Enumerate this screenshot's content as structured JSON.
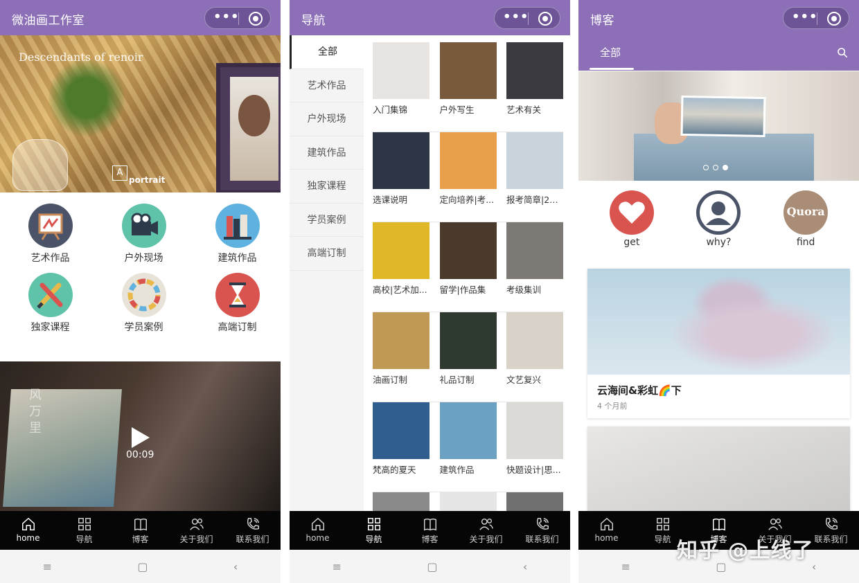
{
  "screen_home": {
    "title": "微油画工作室",
    "hero_caption": "Descendants of renoir",
    "hero_brand": "portrait",
    "hero_logo": "A",
    "grid": [
      {
        "label": "艺术作品",
        "icon": "easel-icon",
        "color": "#4a5367"
      },
      {
        "label": "户外现场",
        "icon": "camera-icon",
        "color": "#5fc3aa"
      },
      {
        "label": "建筑作品",
        "icon": "books-icon",
        "color": "#5fb2e0"
      },
      {
        "label": "独家课程",
        "icon": "brushes-icon",
        "color": "#5fc3aa"
      },
      {
        "label": "学员案例",
        "icon": "palette-icon",
        "color": "#e7e3d8"
      },
      {
        "label": "高端订制",
        "icon": "hourglass-icon",
        "color": "#d9534f"
      }
    ],
    "video": {
      "time": "00:09",
      "overlay_text": "风万里"
    }
  },
  "screen_nav": {
    "title": "导航",
    "categories": [
      "全部",
      "艺术作品",
      "户外现场",
      "建筑作品",
      "独家课程",
      "学员案例",
      "高端订制"
    ],
    "active_category": "全部",
    "thumbs": [
      {
        "caption": "入门集锦",
        "color": "#e8e4e2"
      },
      {
        "caption": "户外写生",
        "color": "#7a5a3c"
      },
      {
        "caption": "艺术有关",
        "color": "#3b3a40"
      },
      {
        "caption": "选课说明",
        "color": "#2c3644"
      },
      {
        "caption": "定向培养|考...",
        "color": "#e9a04a"
      },
      {
        "caption": "报考简章|20...",
        "color": "#c9d3dc"
      },
      {
        "caption": "高校|艺术加...",
        "color": "#e0b727"
      },
      {
        "caption": "留学|作品集",
        "color": "#4a3a2c"
      },
      {
        "caption": "考级集训",
        "color": "#7d7a76"
      },
      {
        "caption": "油画订制",
        "color": "#c09a55"
      },
      {
        "caption": "礼品订制",
        "color": "#2e3a2f"
      },
      {
        "caption": "文艺复兴",
        "color": "#d9d2c8"
      },
      {
        "caption": "梵高的夏天",
        "color": "#2f5e8f"
      },
      {
        "caption": "建筑作品",
        "color": "#6ba2c4"
      },
      {
        "caption": "快题设计|思...",
        "color": "#dcdad6"
      },
      {
        "caption": "",
        "color": "#8a8a8a"
      },
      {
        "caption": "",
        "color": "#e5e5e5"
      },
      {
        "caption": "",
        "color": "#707070"
      }
    ]
  },
  "screen_blog": {
    "title": "博客",
    "tab": "全部",
    "banner_dots": 3,
    "banner_active_dot": 2,
    "icons": [
      {
        "label": "get",
        "icon": "heart-icon",
        "color": "#d9534f"
      },
      {
        "label": "why?",
        "icon": "user-icon",
        "color": "#4a5367"
      },
      {
        "label": "find",
        "icon": "quora-icon",
        "color": "#a98d76",
        "glyph": "Quora"
      }
    ],
    "posts": [
      {
        "title": "云海间&彩虹🌈下",
        "time": "4 个月前"
      },
      {
        "title": "",
        "time": ""
      }
    ]
  },
  "tabbar": [
    {
      "label": "home",
      "icon": "home-icon"
    },
    {
      "label": "导航",
      "icon": "grid-icon"
    },
    {
      "label": "博客",
      "icon": "book-icon"
    },
    {
      "label": "关于我们",
      "icon": "people-icon"
    },
    {
      "label": "联系我们",
      "icon": "phone-icon"
    }
  ],
  "active_tab": {
    "screen_home": 0,
    "screen_nav": 1,
    "screen_blog": 2
  },
  "watermark": "知乎 @上线了",
  "colors": {
    "topbar": "#8d6fb8",
    "tabbar": "#060606"
  }
}
